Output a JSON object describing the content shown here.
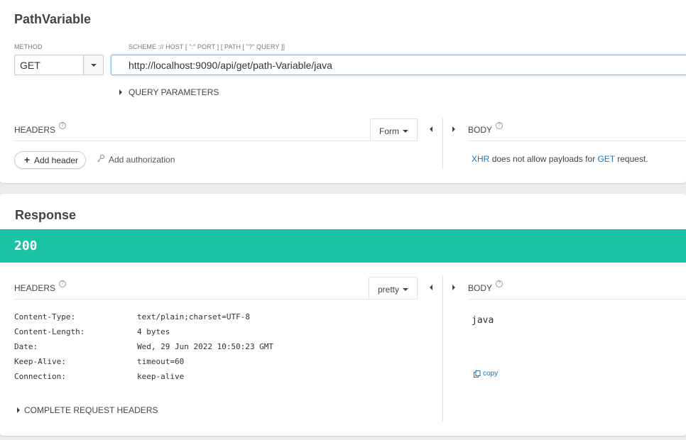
{
  "request": {
    "title": "PathVariable",
    "method_label": "METHOD",
    "url_label": "SCHEME :// HOST [ \":\" PORT ] [ PATH [ \"?\" QUERY ]]",
    "method": "GET",
    "url": "http://localhost:9090/api/get/path-Variable/java",
    "query_parameters": "QUERY PARAMETERS",
    "headers_label": "HEADERS",
    "format": "Form",
    "body_label": "BODY",
    "add_header": "Add header",
    "add_authorization": "Add authorization",
    "body_note": {
      "xhr": "XHR",
      "mid": "does not allow payloads for",
      "get": "GET",
      "end": "request."
    }
  },
  "response": {
    "title": "Response",
    "status": "200",
    "status_color": "#1bc3a5",
    "headers_label": "HEADERS",
    "format": "pretty",
    "body_label": "BODY",
    "headers": [
      {
        "key": "Content-Type:",
        "value": "text/plain;charset=UTF-8"
      },
      {
        "key": "Content-Length:",
        "value": "4 bytes"
      },
      {
        "key": "Date:",
        "value": "Wed, 29 Jun 2022 10:50:23 GMT"
      },
      {
        "key": "Keep-Alive:",
        "value": "timeout=60"
      },
      {
        "key": "Connection:",
        "value": "keep-alive"
      }
    ],
    "body": "java",
    "copy_label": "copy",
    "complete_request_headers": "COMPLETE REQUEST HEADERS"
  },
  "icons": {
    "help": "question-circle-icon",
    "caret": "caret-down-icon",
    "expand": "triangle-right-icon",
    "collapse": "triangle-left-icon",
    "plus": "plus-icon",
    "key": "key-icon",
    "copy": "copy-icon"
  },
  "colors": {
    "accent": "#1b75bb",
    "url_focus": "#7fb6e6"
  }
}
